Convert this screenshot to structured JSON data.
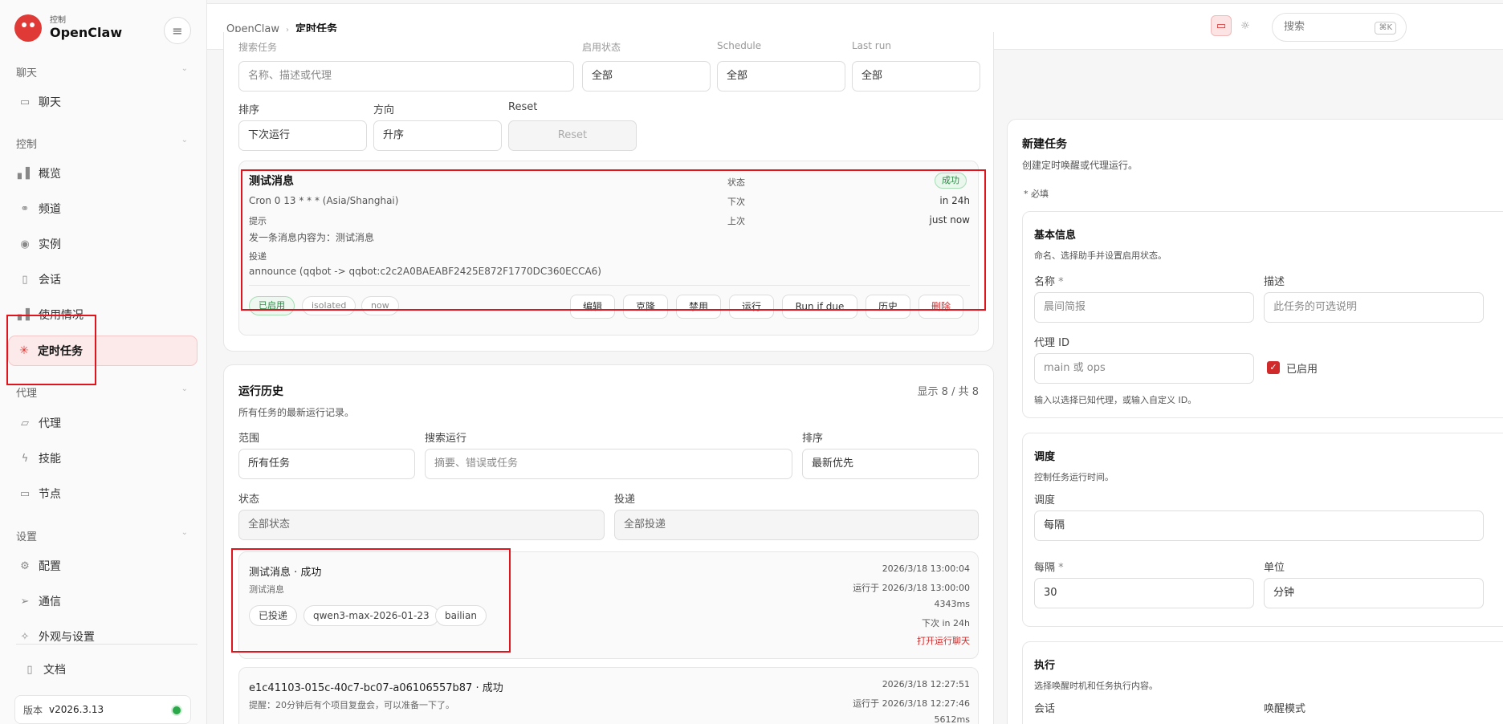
{
  "brand": {
    "subtitle": "控制",
    "title": "OpenClaw"
  },
  "sidebar": {
    "sections": {
      "chat": "聊天",
      "control": "控制",
      "agent": "代理",
      "settings": "设置"
    },
    "items": {
      "chat": "聊天",
      "overview": "概览",
      "channels": "频道",
      "instances": "实例",
      "sessions": "会话",
      "usage": "使用情况",
      "cron": "定时任务",
      "agents": "代理",
      "skills": "技能",
      "nodes": "节点",
      "config": "配置",
      "comm": "通信",
      "appearance": "外观与设置",
      "docs": "文档"
    },
    "version_label": "版本",
    "version": "v2026.3.13"
  },
  "header": {
    "crumb_root": "OpenClaw",
    "crumb_current": "定时任务",
    "search_placeholder": "搜索",
    "search_kbd": "⌘K"
  },
  "filters": {
    "top_labels": [
      "搜索任务",
      "启用状态",
      "Schedule",
      "Last run"
    ],
    "search_placeholder": "名称、描述或代理",
    "enabled": "全部",
    "schedule": "全部",
    "last_run": "全部",
    "sort_label": "排序",
    "sort_value": "下次运行",
    "dir_label": "方向",
    "dir_value": "升序",
    "reset_label": "Reset",
    "reset_button": "Reset"
  },
  "job": {
    "title": "测试消息",
    "schedule": "Cron 0 13 * * * (Asia/Shanghai)",
    "prompt_label": "提示",
    "prompt": "发一条消息内容为：测试消息",
    "delivery_label": "投递",
    "delivery": "announce (qqbot -> qqbot:c2c2A0BAEABF2425E872F1770DC360ECCA6)",
    "status_label": "状态",
    "status": "成功",
    "next_label": "下次",
    "next": "in 24h",
    "last_label": "上次",
    "last": "just now",
    "tags": [
      "已启用",
      "isolated",
      "now"
    ],
    "actions": [
      "编辑",
      "克隆",
      "禁用",
      "运行",
      "Run if due",
      "历史",
      "删除"
    ]
  },
  "history": {
    "title": "运行历史",
    "subtitle": "所有任务的最新运行记录。",
    "count": "显示 8 / 共 8",
    "scope_label": "范围",
    "scope_value": "所有任务",
    "search_label": "搜索运行",
    "search_placeholder": "摘要、错误或任务",
    "sort_label": "排序",
    "sort_value": "最新优先",
    "status_label": "状态",
    "status_value": "全部状态",
    "delivery_label": "投递",
    "delivery_value": "全部投递",
    "runs": [
      {
        "title": "测试消息 · 成功",
        "summary": "测试消息",
        "tags": [
          "已投递",
          "qwen3-max-2026-01-23",
          "bailian"
        ],
        "time": "2026/3/18 13:00:04",
        "ran_at": "运行于 2026/3/18 13:00:00",
        "duration": "4343ms",
        "next": "下次 in 24h",
        "link": "打开运行聊天"
      },
      {
        "title": "e1c41103-015c-40c7-bc07-a06106557b87 · 成功",
        "summary": "提醒：20分钟后有个项目复盘会，可以准备一下了。",
        "time": "2026/3/18 12:27:51",
        "ran_at": "运行于 2026/3/18 12:27:46",
        "duration": "5612ms"
      }
    ]
  },
  "new_job": {
    "title": "新建任务",
    "subtitle": "创建定时唤醒或代理运行。",
    "required": "* 必填",
    "basic_title": "基本信息",
    "basic_sub": "命名、选择助手并设置启用状态。",
    "name_label": "名称",
    "name_placeholder": "晨间简报",
    "desc_label": "描述",
    "desc_placeholder": "此任务的可选说明",
    "agent_label": "代理 ID",
    "agent_placeholder": "main 或 ops",
    "agent_hint": "输入以选择已知代理，或输入自定义 ID。",
    "enabled_label": "已启用",
    "sched_title": "调度",
    "sched_sub": "控制任务运行时间。",
    "sched_label": "调度",
    "sched_value": "每隔",
    "every_label": "每隔",
    "every_value": "30",
    "unit_label": "单位",
    "unit_value": "分钟",
    "exec_title": "执行",
    "exec_sub": "选择唤醒时机和任务执行内容。",
    "session_label": "会话",
    "wake_label": "唤醒模式"
  },
  "colors": {
    "accent": "#e03a36",
    "success": "#2a8a43",
    "annotation": "#e0141c"
  }
}
